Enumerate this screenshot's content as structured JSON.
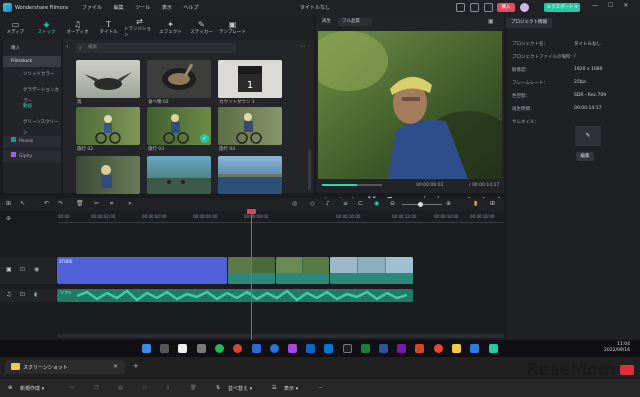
{
  "app": {
    "name": "Wondershare Filmora",
    "menus": [
      "ファイル",
      "編集",
      "ツール",
      "表示",
      "ヘルプ"
    ],
    "window_title": "タイトルなし",
    "buy_label": "購入",
    "export_label": "エクスポート ▾",
    "brand_color": "#23c9a4"
  },
  "tabs": [
    {
      "label": "メディア",
      "icon": "media-icon"
    },
    {
      "label": "ストック",
      "icon": "stock-icon",
      "active": true
    },
    {
      "label": "オーディオ",
      "icon": "music-icon"
    },
    {
      "label": "タイトル",
      "icon": "title-icon"
    },
    {
      "label": "トランジション",
      "icon": "transition-icon"
    },
    {
      "label": "エフェクト",
      "icon": "effect-icon"
    },
    {
      "label": "ステッカー",
      "icon": "sticker-icon"
    },
    {
      "label": "テンプレート",
      "icon": "template-icon"
    }
  ],
  "library_sidebar": {
    "items": [
      "購入",
      "Filmstock",
      "ソリッドカラー",
      "グラデーションカラー",
      "動画",
      "グリーンスクリーン",
      "Pexels",
      "Giphy"
    ]
  },
  "media_grid": {
    "search_placeholder": "検索",
    "items": [
      "鳥",
      "食べ物 02",
      "カウントダウン 1",
      "旅行 02",
      "旅行 03",
      "旅行 04",
      "",
      "",
      ""
    ]
  },
  "preview": {
    "label": "再生",
    "quality": "フル品質",
    "current_time": "00:00:06:01",
    "total_time": "/ 00:00:14:17",
    "progress": 0.58
  },
  "properties": {
    "tab": "プロジェクト情報",
    "rows": [
      {
        "label": "プロジェクト名：",
        "value": "タイトルなし"
      },
      {
        "label": "プロジェクトファイルの場所：",
        "value": "/"
      },
      {
        "label": "解像度：",
        "value": "1920 x 1080"
      },
      {
        "label": "フレームレート：",
        "value": "25fps"
      },
      {
        "label": "色空間：",
        "value": "SDR - Rec.709"
      },
      {
        "label": "再生時間：",
        "value": "00:00:14:17"
      },
      {
        "label": "サムネイル：",
        "value": ""
      }
    ],
    "edit_label": "編集"
  },
  "timeline": {
    "ruler": [
      "00:00",
      "00:00:02:00",
      "00:00:04:00",
      "00:00:06:00",
      "00:00:08:00",
      "00:00:10:00",
      "00:00:12:00",
      "00:00:14:00",
      "00:00:16:00"
    ],
    "clips": {
      "title_clip": "STORE",
      "audio_clip": "ソフト"
    },
    "playhead_time": "00:00:06:00"
  },
  "taskbar": {
    "time": "11:04",
    "date": "2022/09/16"
  },
  "explorer": {
    "tab": "スクリーンショット",
    "new_label": "新規作成 ▾",
    "sort_label": "並べ替え ▾",
    "view_label": "表示 ▾"
  },
  "watermark": "ReseMom"
}
